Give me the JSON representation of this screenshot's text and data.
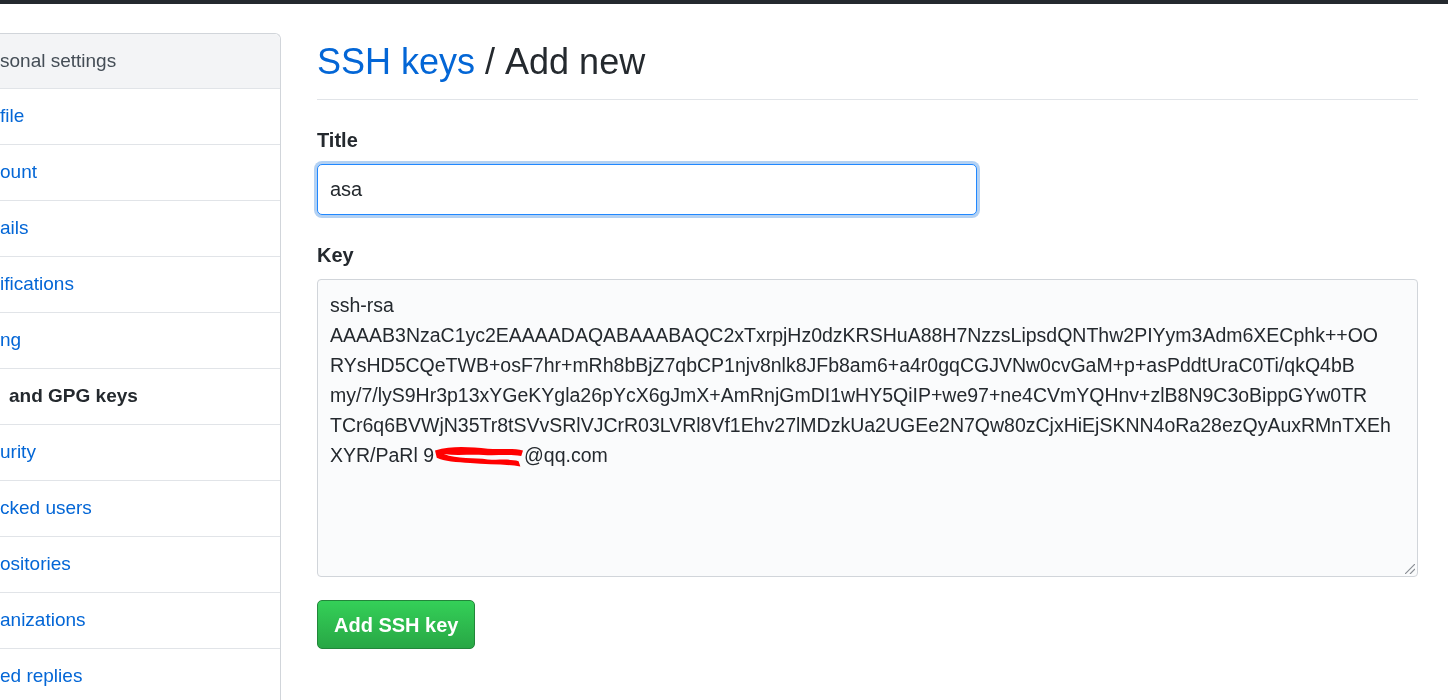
{
  "sidebar": {
    "header": "sonal settings",
    "items": [
      {
        "label": "file",
        "selected": false
      },
      {
        "label": "ount",
        "selected": false
      },
      {
        "label": "ails",
        "selected": false
      },
      {
        "label": "ifications",
        "selected": false
      },
      {
        "label": "ng",
        "selected": false
      },
      {
        "label": "and GPG keys",
        "selected": true
      },
      {
        "label": "urity",
        "selected": false
      },
      {
        "label": "cked users",
        "selected": false
      },
      {
        "label": "ositories",
        "selected": false
      },
      {
        "label": "anizations",
        "selected": false
      },
      {
        "label": "ed replies",
        "selected": false
      }
    ]
  },
  "heading": {
    "parent_link": "SSH keys",
    "separator": "/",
    "title": "Add new"
  },
  "form": {
    "title_field": {
      "label": "Title",
      "value": "asa",
      "focused": true
    },
    "key_field": {
      "label": "Key",
      "lines": [
        [
          {
            "kind": "text",
            "text": "ssh-rsa"
          }
        ],
        [
          {
            "kind": "text",
            "text": "AAAAB3NzaC1yc2EAAAADAQABAAABAQC2xTxrpjHz0dzKRSHuA88H7NzzsLipsdQNThw2PIYym3Adm6XECphk++OO"
          }
        ],
        [
          {
            "kind": "text",
            "text": "RYsHD5CQeTWB+osF7hr+mRh8bBjZ7qbCP1njv8nlk8JFb8am6+a4r0gqCGJVNw0cvGaM+p+asPddtUraC0Ti/qkQ4bB"
          }
        ],
        [
          {
            "kind": "text",
            "text": "my/7/lyS9Hr3p13xYGeKYgla26pYcX6gJmX+AmRnjGmDI1wHY5QiIP+we97+ne4CVmYQHnv+zlB8N9C3oBippGYw0TR"
          }
        ],
        [
          {
            "kind": "text",
            "text": "TCr6q6BVWjN35Tr8tSVvSRlVJCrR03LVRl8Vf1Ehv27lMDzkUa2UGEe2N7Qw80zCjxHiEjSKNN4oRa28ezQyAuxRMnTXEh"
          }
        ],
        [
          {
            "kind": "text",
            "text": "XYR/PaRl 9"
          },
          {
            "kind": "redaction"
          },
          {
            "kind": "text",
            "text": "@qq.com"
          }
        ]
      ]
    },
    "submit_button": "Add SSH key"
  }
}
